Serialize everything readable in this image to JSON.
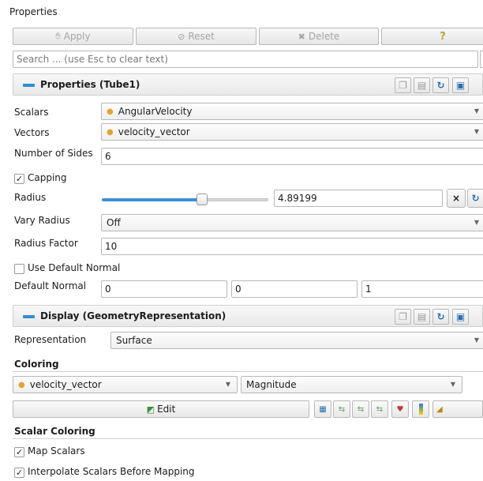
{
  "panel_title": "Properties",
  "toolbar": {
    "apply_label": "Apply",
    "reset_label": "Reset",
    "delete_label": "Delete",
    "help_label": "?"
  },
  "search": {
    "placeholder": "Search ... (use Esc to clear text)"
  },
  "properties_section": {
    "title": "Properties (Tube1)",
    "scalars_label": "Scalars",
    "scalars_value": "AngularVelocity",
    "vectors_label": "Vectors",
    "vectors_value": "velocity_vector",
    "sides_label": "Number of Sides",
    "sides_value": "6",
    "capping_label": "Capping",
    "capping_checked": true,
    "radius_label": "Radius",
    "radius_value": "4.89199",
    "radius_slider_fraction": 0.57,
    "vary_radius_label": "Vary Radius",
    "vary_radius_value": "Off",
    "radius_factor_label": "Radius Factor",
    "radius_factor_value": "10",
    "use_default_normal_label": "Use Default Normal",
    "use_default_normal_checked": false,
    "default_normal_label": "Default Normal",
    "default_normal_values": [
      "0",
      "0",
      "1"
    ]
  },
  "display_section": {
    "title": "Display (GeometryRepresentation)",
    "representation_label": "Representation",
    "representation_value": "Surface",
    "coloring_heading": "Coloring",
    "color_array": "velocity_vector",
    "color_component": "Magnitude",
    "edit_label": "Edit",
    "scalar_coloring_heading": "Scalar Coloring",
    "map_scalars_label": "Map Scalars",
    "map_scalars_checked": true,
    "interpolate_label": "Interpolate Scalars Before Mapping",
    "interpolate_checked": true
  },
  "colors": {
    "accent_blue": "#2f8fd0",
    "slider_blue": "#3c8fd6",
    "array_dot": "#e0a43a"
  }
}
